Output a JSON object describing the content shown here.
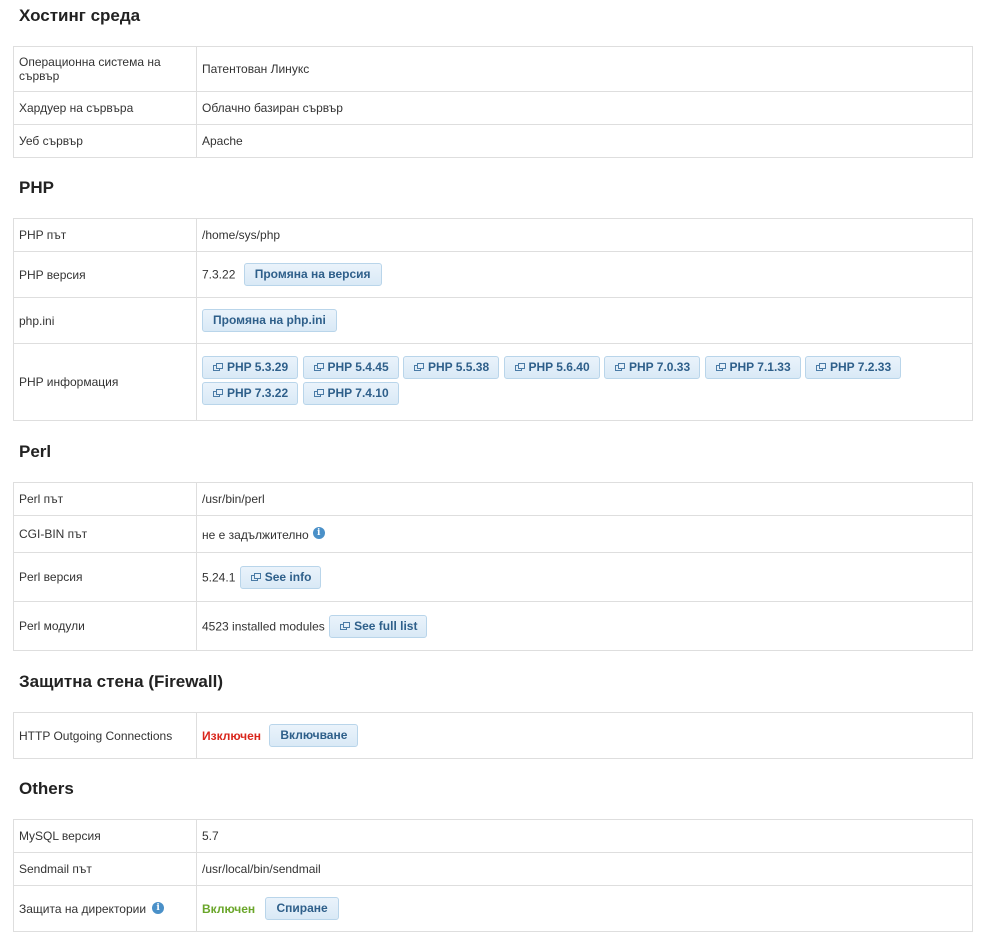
{
  "hosting": {
    "title": "Хостинг среда",
    "rows": {
      "os_label": "Операционна система на сървър",
      "os_value": "Патентован Линукс",
      "hw_label": "Хардуер на сървъра",
      "hw_value": "Облачно базиран сървър",
      "web_label": "Уеб сървър",
      "web_value": "Apache"
    }
  },
  "php": {
    "title": "PHP",
    "path_label": "PHP път",
    "path_value": "/home/sys/php",
    "version_label": "PHP версия",
    "version_value": "7.3.22",
    "change_version_label": "Промяна на версия",
    "ini_label": "php.ini",
    "change_ini_label": "Промяна на php.ini",
    "info_label": "PHP информация",
    "info_buttons": [
      "PHP 5.3.29",
      "PHP 5.4.45",
      "PHP 5.5.38",
      "PHP 5.6.40",
      "PHP 7.0.33",
      "PHP 7.1.33",
      "PHP 7.2.33",
      "PHP 7.3.22",
      "PHP 7.4.10"
    ]
  },
  "perl": {
    "title": "Perl",
    "path_label": "Perl път",
    "path_value": "/usr/bin/perl",
    "cgi_label": "CGI-BIN път",
    "cgi_value": "не е задължително",
    "version_label": "Perl версия",
    "version_value": "5.24.1",
    "see_info_label": "See info",
    "modules_label": "Perl модули",
    "modules_value": "4523 installed modules",
    "see_full_list_label": "See full list"
  },
  "firewall": {
    "title": "Защитна стена (Firewall)",
    "http_label": "HTTP Outgoing Connections",
    "http_status": "Изключен",
    "enable_label": "Включване"
  },
  "others": {
    "title": "Others",
    "mysql_label": "MySQL версия",
    "mysql_value": "5.7",
    "sendmail_label": "Sendmail път",
    "sendmail_value": "/usr/local/bin/sendmail",
    "dirprot_label": "Защита на директории",
    "dirprot_status": "Включен",
    "stop_label": "Спиране"
  },
  "icons": {
    "info": "info-icon",
    "external": "external-link-icon"
  },
  "colors": {
    "status_off": "#d9261c",
    "status_on": "#6aa62a",
    "button_text": "#2e5f8a",
    "info_icon": "#4a90c8"
  }
}
